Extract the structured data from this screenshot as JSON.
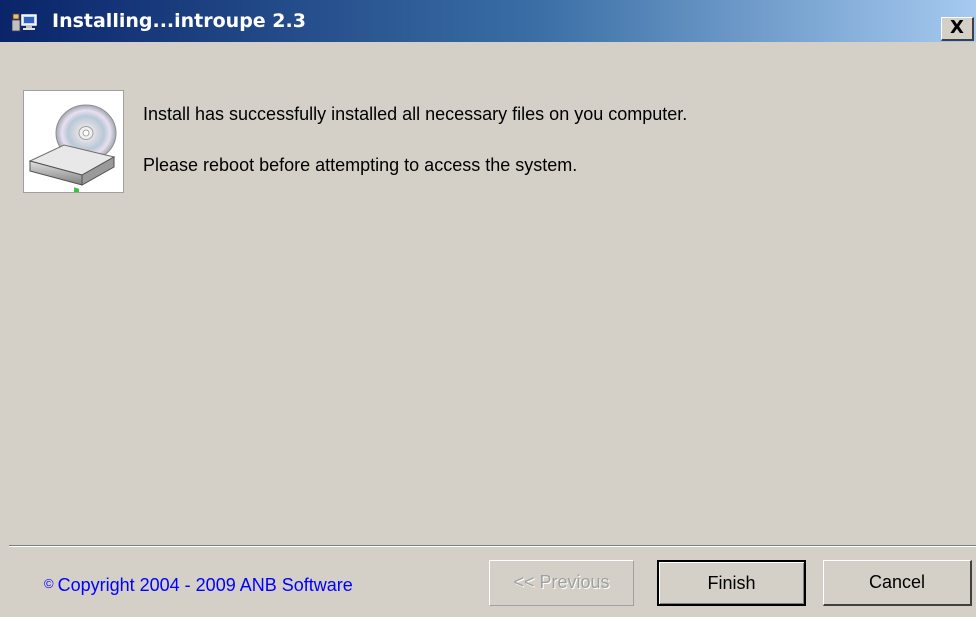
{
  "window": {
    "title": "Installing...introupe 2.3",
    "close_label": "X"
  },
  "content": {
    "icon": "cd-drive-icon",
    "message_line1": "Install has successfully installed all necessary files on you computer.",
    "message_line2": "Please reboot before attempting to access the system."
  },
  "footer": {
    "copyright_symbol": "©",
    "copyright_text": "Copyright 2004 - 2009 ANB Software",
    "buttons": {
      "previous": "<< Previous",
      "finish": "Finish",
      "cancel": "Cancel"
    }
  },
  "colors": {
    "title_gradient_start": "#0a246a",
    "title_gradient_end": "#a6caf0",
    "dialog_background": "#d4d0c8",
    "copyright_link": "#0000ff"
  }
}
